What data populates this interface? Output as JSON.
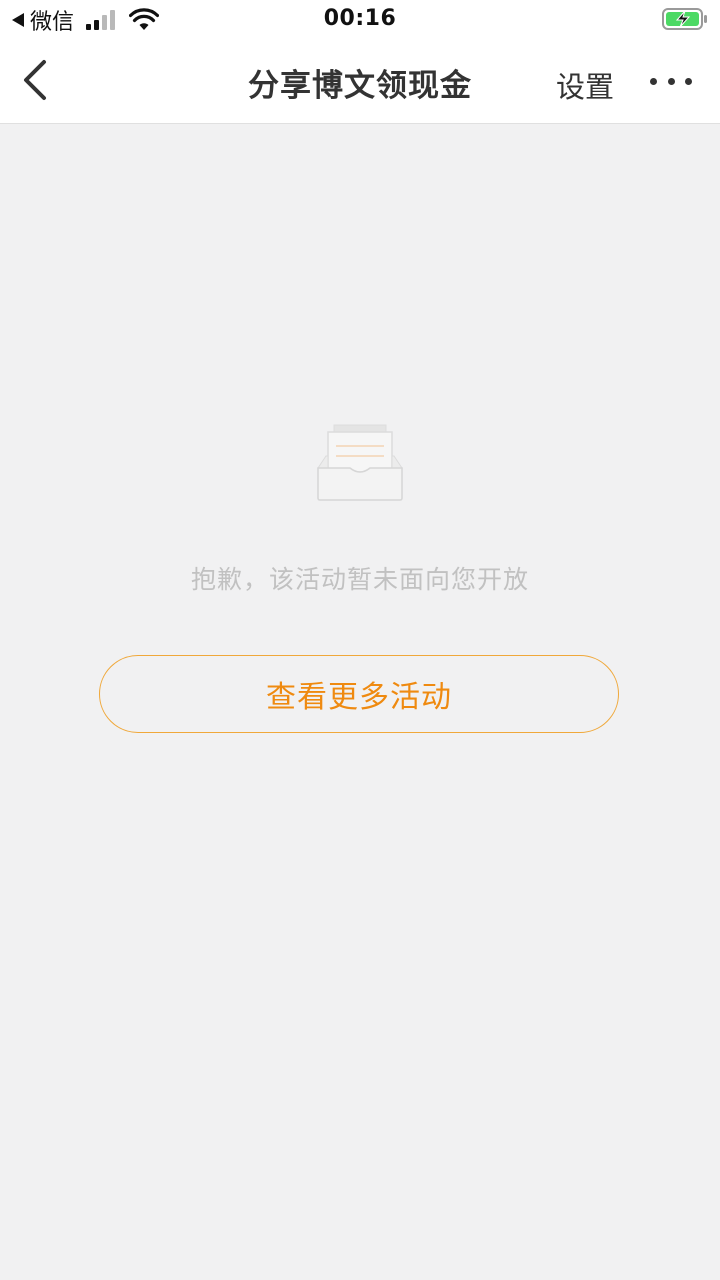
{
  "status_bar": {
    "carrier": "微信",
    "time": "00:16"
  },
  "nav": {
    "title": "分享博文领现金",
    "settings_label": "设置"
  },
  "empty_state": {
    "message": "抱歉，该活动暂未面向您开放",
    "button_label": "查看更多活动"
  },
  "colors": {
    "accent": "#ef8a10",
    "button_border": "#f0a83a",
    "background": "#f1f1f2",
    "battery_charging": "#4cd964"
  },
  "icons": {
    "back": "chevron-left-icon",
    "more": "ellipsis-icon",
    "empty": "empty-inbox-icon",
    "wifi": "wifi-icon",
    "battery": "battery-charging-icon",
    "signal": "signal-strength-icon"
  }
}
